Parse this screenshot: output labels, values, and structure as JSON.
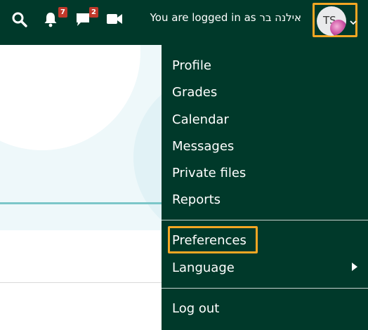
{
  "navbar": {
    "notifications_count": "7",
    "messages_count": "2",
    "login_text": "You are logged in as אילנה בר",
    "avatar_initials": "TS"
  },
  "user_menu": {
    "items": [
      "Profile",
      "Grades",
      "Calendar",
      "Messages",
      "Private files",
      "Reports"
    ],
    "preferences": "Preferences",
    "language": "Language",
    "logout": "Log out"
  },
  "colors": {
    "navbar_bg": "#00392a",
    "focus_outline": "#f5a623",
    "badge": "#c0392b"
  }
}
